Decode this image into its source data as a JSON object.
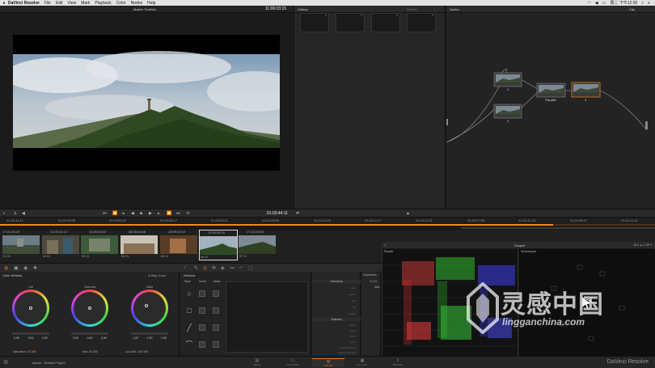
{
  "menubar": {
    "app": "DaVinci Resolve",
    "items": [
      "File",
      "Edit",
      "View",
      "Mark",
      "Playback",
      "Color",
      "Nodes",
      "Help"
    ],
    "clock": "周二 下午12:00"
  },
  "viewer": {
    "timeline": "Master Timeline",
    "timecode": "11:06:03:15"
  },
  "gallery": {
    "title": "Gallery",
    "search": "Search",
    "stills": [
      "6",
      "6",
      "6",
      "6"
    ]
  },
  "nodes": {
    "title": "Nodes",
    "mode": "Clip",
    "items": [
      {
        "label": "1"
      },
      {
        "label": "2"
      },
      {
        "label": "Parallel"
      },
      {
        "label": "4"
      }
    ]
  },
  "transport": {
    "timecode": "01:03:44:11"
  },
  "ruler": {
    "labels": [
      "01:03:44:11",
      "01:03:49:05",
      "01:03:53:22",
      "01:03:58:17",
      "01:04:03:11",
      "01:04:08:05",
      "01:04:12:23",
      "01:04:17:17",
      "01:04:22:11",
      "01:04:27:05",
      "01:04:31:23",
      "01:04:36:17",
      "01:04:41:11"
    ],
    "progress": 0.845
  },
  "clips": [
    {
      "tc": "17:21:16:09",
      "name": "01 V1"
    },
    {
      "tc": "21:03:41:14",
      "name": "02 V1"
    },
    {
      "tc": "11:05:04:20",
      "name": "03 V1"
    },
    {
      "tc": "08:05:44:06",
      "name": "04 V1"
    },
    {
      "tc": "23:09:32:10",
      "name": "05 V1"
    },
    {
      "tc": "11:06:03:15",
      "name": "06 V1"
    },
    {
      "tc": "17:22:23:02",
      "name": "07 V1"
    }
  ],
  "color_wheels": {
    "title": "Color Wheels",
    "mode": "3-Way Color",
    "wheels": [
      {
        "name": "Lift",
        "vals": [
          "0.00",
          "0.00",
          "0.00"
        ]
      },
      {
        "name": "Gamma",
        "vals": [
          "0.00",
          "0.00",
          "0.00"
        ]
      },
      {
        "name": "Gain",
        "vals": [
          "1.00",
          "1.00",
          "1.00"
        ]
      }
    ],
    "saturation_label": "Saturation",
    "saturation": "37.600",
    "hue": "Hue: 50.000",
    "lum_mix": "Lum Mix: 100.000"
  },
  "window": {
    "title": "Window",
    "cols": [
      "Style",
      "Invert",
      "Mask"
    ]
  },
  "transform": {
    "title": "Transform",
    "rows": [
      "Size",
      "Aspect",
      "Pan",
      "Tilt",
      "Rotate"
    ],
    "softness_title": "Softness",
    "soft_rows": [
      "Soft 1",
      "Soft 2",
      "Soft 3",
      "Soft 4",
      "Inside Softness",
      "Outside Softness"
    ]
  },
  "keyframes": {
    "title": "Keyframes",
    "tc": "01:03:",
    "sub": "Mas"
  },
  "scopes": {
    "title": "Scopes",
    "parade": "Parade",
    "vectorscope": "Vectorscope",
    "right": "16:9  ▲   2 UP ▾"
  },
  "status": {
    "user": "admin - Default Project",
    "pages": [
      "MEDIA",
      "CONFORM",
      "COLOR",
      "GALLERY",
      "DELIVER"
    ],
    "active_page": "COLOR",
    "brand": "DaVinci Resolve"
  },
  "watermark": {
    "cn": "灵感中国",
    "en": "lingganchina.com"
  },
  "colors": {
    "accent": "#e07a1a",
    "bg": "#1e1e1e"
  }
}
